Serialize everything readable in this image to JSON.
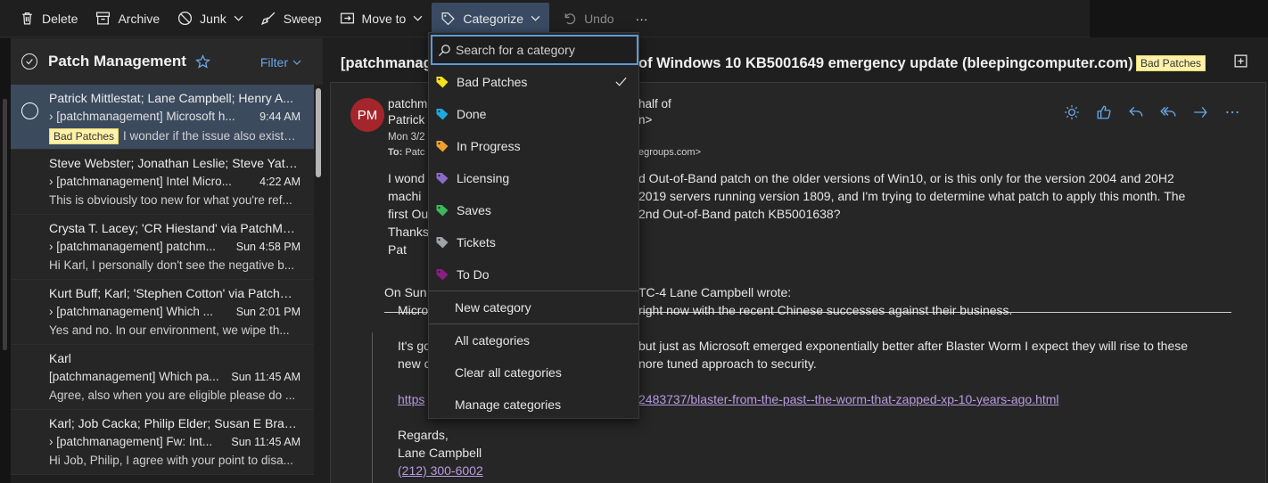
{
  "toolbar": {
    "delete": "Delete",
    "archive": "Archive",
    "junk": "Junk",
    "sweep": "Sweep",
    "move_to": "Move to",
    "categorize": "Categorize",
    "undo": "Undo",
    "more": "···"
  },
  "folder": {
    "title": "Patch Management",
    "filter": "Filter"
  },
  "messages": [
    {
      "sender": "Patrick Mittlestat; Lane Campbell; Henry A...",
      "subject": "[patchmanagement] Microsoft h...",
      "time": "9:44 AM",
      "tag": "Bad Patches",
      "preview": "I wonder if the issue also exists ..."
    },
    {
      "sender": "Steve Webster; Jonathan Leslie; Steve Yates;...",
      "subject": "[patchmanagement] Intel Micro...",
      "time": "4:22 AM",
      "preview": "This is obviously too new for what you're ref..."
    },
    {
      "sender": "Crysta T. Lacey; 'CR Hiestand' via PatchMan...",
      "subject": "[patchmanagement] patchm...",
      "time": "Sun 4:58 PM",
      "preview": "Hi Karl, I personally don't see the negative b..."
    },
    {
      "sender": "Kurt Buff; Karl; 'Stephen Cotton' via PatchM...",
      "subject": "[patchmanagement] Which ...",
      "time": "Sun 2:01 PM",
      "preview": "Yes and no. In our environment, we wipe th..."
    },
    {
      "sender": "Karl",
      "subject": "[patchmanagement] Which pa...",
      "time": "Sun 11:45 AM",
      "preview": "Agree, also when you are eligible please do ..."
    },
    {
      "sender": "Karl; Job Cacka; Philip Elder; Susan E Bradley",
      "subject": "[patchmanagement] Fw: Int...",
      "time": "Sun 11:45 AM",
      "preview": "Hi Job, Philip, I agree with your point to disa..."
    }
  ],
  "reading": {
    "subject_left": "[patchmanag",
    "subject_right": "of Windows 10 KB5001649 emergency update (bleepingcomputer.com)",
    "subject_tag": "Bad Patches",
    "avatar": "PM",
    "from1_left": "patchm",
    "from1_right": "half of",
    "from2_left": "Patrick",
    "from2_right": "n>",
    "date": "Mon 3/2",
    "to_label": "To:",
    "to_left": "Patc",
    "to_right": "egroups.com>",
    "body": [
      {
        "left": "I wond",
        "right": "d Out-of-Band patch on the older versions of Win10, or is this only for the version 2004 and 20H2"
      },
      {
        "left": "machi",
        "right": "2019 servers  running version 1809, and I'm trying to determine what patch to apply this month.  The"
      },
      {
        "left": "first Ou",
        "right": "2nd Out-of-Band patch KB5001638?"
      },
      {
        "left": "Thanks",
        "right": ""
      },
      {
        "left": "Pat",
        "right": ""
      }
    ],
    "quote_header_left": "On Sun",
    "quote_header_right": "TC-4 Lane Campbell wrote:",
    "quote_line1_left": "Micro",
    "quote_line1_right": "right now with the recent Chinese successes against their business.",
    "quote_line2_left": "It's go",
    "quote_line2_right": "but just as Microsoft emerged exponentially better after Blaster Worm I expect they will rise to these",
    "quote_line3_left": "new c",
    "quote_line3_right": "nore tuned approach to security.",
    "link_left": "https",
    "link_right": "2483737/blaster-from-the-past--the-worm-that-zapped-xp-10-years-ago.html",
    "regards": "Regards,",
    "signature": "Lane Campbell",
    "phone": "(212) 300-6002"
  },
  "category_menu": {
    "search_placeholder": "Search for a category",
    "categories": [
      {
        "label": "Bad Patches",
        "color": "#f6e21b",
        "checked": true
      },
      {
        "label": "Done",
        "color": "#1fa8e0",
        "checked": false
      },
      {
        "label": "In Progress",
        "color": "#f0a030",
        "checked": false
      },
      {
        "label": "Licensing",
        "color": "#8a6cc8",
        "checked": false
      },
      {
        "label": "Saves",
        "color": "#3cb85c",
        "checked": false
      },
      {
        "label": "Tickets",
        "color": "#9ea3a8",
        "checked": false
      },
      {
        "label": "To Do",
        "color": "#8a1d80",
        "checked": false
      }
    ],
    "new_category": "New category",
    "all_categories": "All categories",
    "clear_all": "Clear all categories",
    "manage": "Manage categories"
  }
}
